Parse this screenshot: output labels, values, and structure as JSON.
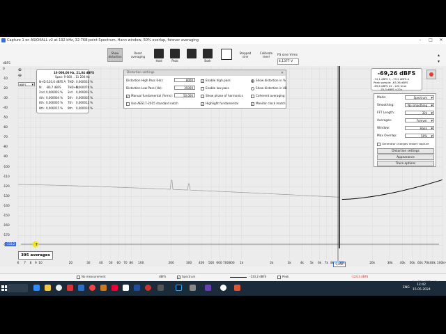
{
  "window": {
    "title": "Capture 1 on ASIO4ALL v2 at 192 kHz, 32 768-point Spectrum, Hann window, 50% overlap, forever averaging",
    "controls": [
      "–",
      "□",
      "✕"
    ]
  },
  "toolbar": {
    "show_distortion": "Show distortion",
    "reset_averaging": "Reset averaging",
    "hold": "Hold",
    "peak": "Peak",
    "both": "Both",
    "stepped_sine": "Stepped sine",
    "calibrate_level": "Calibrate level",
    "fs_sine_label": "FS sine Vrms",
    "fs_sine_value": "4,1377 V"
  },
  "plot": {
    "unit_label": "dBFS",
    "unit_select": "dBFS",
    "y_ticks": [
      "0",
      "-10",
      "-20",
      "-30",
      "-40",
      "-50",
      "-60",
      "-70",
      "-80",
      "-90",
      "-100",
      "-110",
      "-120",
      "-130",
      "-140",
      "-150",
      "-160",
      "-170",
      "-180"
    ],
    "x_ticks": [
      "6",
      "7",
      "8",
      "9",
      "10",
      "20",
      "30",
      "40",
      "50",
      "60",
      "70",
      "80",
      "100",
      "200",
      "300",
      "400",
      "500",
      "600",
      "700",
      "800",
      "1k",
      "2k",
      "3k",
      "4k",
      "5k",
      "6k",
      "7k",
      "8k",
      "10k",
      "20k",
      "30k",
      "40k",
      "50k",
      "60k",
      "70k",
      "80k",
      "100kHz"
    ],
    "cursor_value": "-133,2",
    "cursor_x_value": "9,85k",
    "averages": "395 averages",
    "range_buttons": [
      "10 .. 200",
      "20 .. 20 000"
    ]
  },
  "cursor_info": {
    "header": "10 000,00 Hz, 21,04 dBFS",
    "span": "Span: 9 000 .. 11 200 Hz",
    "rows": [
      [
        "N+D:",
        "-103,6 dBFS A",
        "THD:",
        "0,000033 %"
      ],
      [
        "N:",
        "-80,7 dBFS",
        "THD+N:",
        "0,000076 %"
      ],
      [
        "2nd:",
        "0,000003 %",
        "3rd:",
        "0,000003 %"
      ],
      [
        "4th:",
        "0,000004 %",
        "5th:",
        "0,000005 %"
      ],
      [
        "6th:",
        "0,000005 %",
        "7th:",
        "0,000012 %"
      ],
      [
        "8th:",
        "0,000015 %",
        "9th:",
        "0,000010 %"
      ]
    ]
  },
  "distortion_settings": {
    "title": "Distortion settings",
    "high_pass_label": "Distortion High Pass (Hz):",
    "high_pass_value": "8000",
    "low_pass_label": "Distortion Low Pass (Hz):",
    "low_pass_value": "35000",
    "manual_fundamental_label": "Manual fundamental (Vrms):",
    "manual_fundamental_value": "50,000",
    "aes17_label": "Use AES17-2015 standard notch",
    "enable_high_pass": "Enable high pass",
    "enable_low_pass": "Enable low pass",
    "show_phase": "Show phase of harmonics",
    "highlight_fundamental": "Highlight fundamental",
    "show_pct": "Show distortion in %",
    "show_db": "Show distortion in dB",
    "coherent": "Coherent averaging",
    "monitor_clock": "Monitor clock match"
  },
  "level_panel": {
    "main": "-69,26 dBFS",
    "line2": "-74,1 dBFS C, -73,2 dBFS A",
    "line3": "Peak sample: -63,36 dBFS",
    "line4": "-69,6 dBFS 22 - 22k Unw",
    "line5": "-70,3 dBFS <22k"
  },
  "side_controls": {
    "mode_label": "Mode:",
    "mode_value": "Spectrum",
    "smoothing_label": "Smoothing:",
    "smoothing_value": "No smoothing",
    "fft_label": "FFT Length:",
    "fft_value": "32k",
    "averages_label": "Averages:",
    "averages_value": "Forever",
    "window_label": "Window:",
    "window_value": "Hann",
    "overlap_label": "Max Overlap:",
    "overlap_value": "50%",
    "generator_label": "Generator changes restart capture",
    "btn_distortion": "Distortion settings",
    "btn_appearance": "Appearance",
    "btn_trace": "Trace options"
  },
  "legend": {
    "no_measurement": "No measurement",
    "unit1": "dBFS",
    "spectrum": "Spectrum",
    "spectrum_value": "-133,2 dBFS",
    "peak": "Peak",
    "peak_value": "-124,3 dBFS"
  },
  "taskbar": {
    "time": "12:42",
    "date": "15.05.2024",
    "lang": "ENG"
  },
  "colors": {
    "trace": "#000000",
    "fundamental": "#000000",
    "taskbar": "#1c2b3a",
    "cursor_marker": "#f2e600",
    "record_button": "#e33b2e"
  }
}
